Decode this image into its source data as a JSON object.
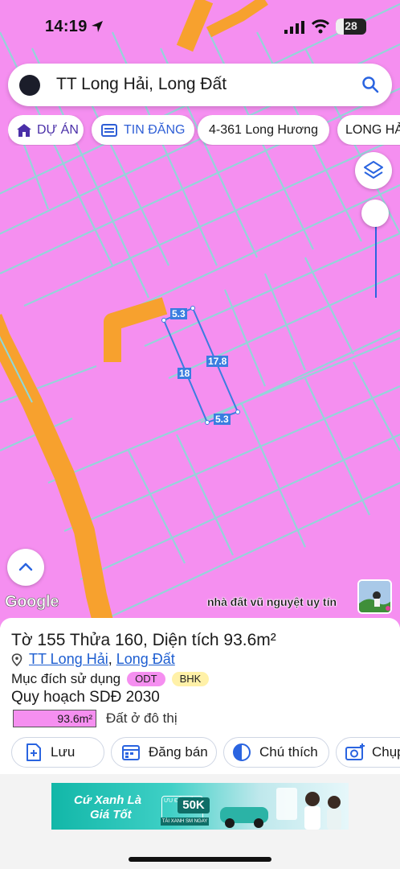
{
  "status_bar": {
    "time": "14:19",
    "battery": "28"
  },
  "search": {
    "query": "TT Long Hải, Long Đất"
  },
  "chips": [
    {
      "label": "DỰ ÁN",
      "icon": "home-icon"
    },
    {
      "label": "TIN ĐĂNG",
      "icon": "listing-icon"
    },
    {
      "label": "4-361 Long Hương"
    },
    {
      "label": "LONG HẢI"
    }
  ],
  "map": {
    "measurements": [
      "5.3",
      "17.8",
      "18",
      "5.3"
    ],
    "attribution": "Google",
    "watermark": "nhà đất vũ nguyệt uy tín",
    "land_color": "#f58ff0",
    "road_color": "#f7a12e",
    "boundary_color": "#8fd8d8",
    "measure_color": "#3a7de0"
  },
  "parcel": {
    "title": "Tờ 155 Thửa 160, Diện tích 93.6m²",
    "location_town": "TT Long Hải",
    "location_separator": ", ",
    "location_district": "Long Đất",
    "purpose_label": "Mục đích sử dụng",
    "badges": [
      {
        "code": "ODT",
        "color": "#f58ff0"
      },
      {
        "code": "BHK",
        "color": "#fff1a8"
      }
    ],
    "plan_title": "Quy hoạch SDĐ 2030",
    "plan_area": "93.6m²",
    "plan_type": "Đất ở đô thị"
  },
  "actions": [
    {
      "label": "Lưu",
      "icon": "add-document-icon"
    },
    {
      "label": "Đăng bán",
      "icon": "calendar-icon"
    },
    {
      "label": "Chú thích",
      "icon": "half-circle-icon"
    },
    {
      "label": "Chụp",
      "icon": "camera-plus-icon"
    }
  ],
  "ad": {
    "line1": "Cứ Xanh Là",
    "line2": "Giá Tốt",
    "offer": "ƯU ĐÃI ĐẾN",
    "amount": "50K",
    "sub": "TÀI XANH SM NGAY"
  }
}
